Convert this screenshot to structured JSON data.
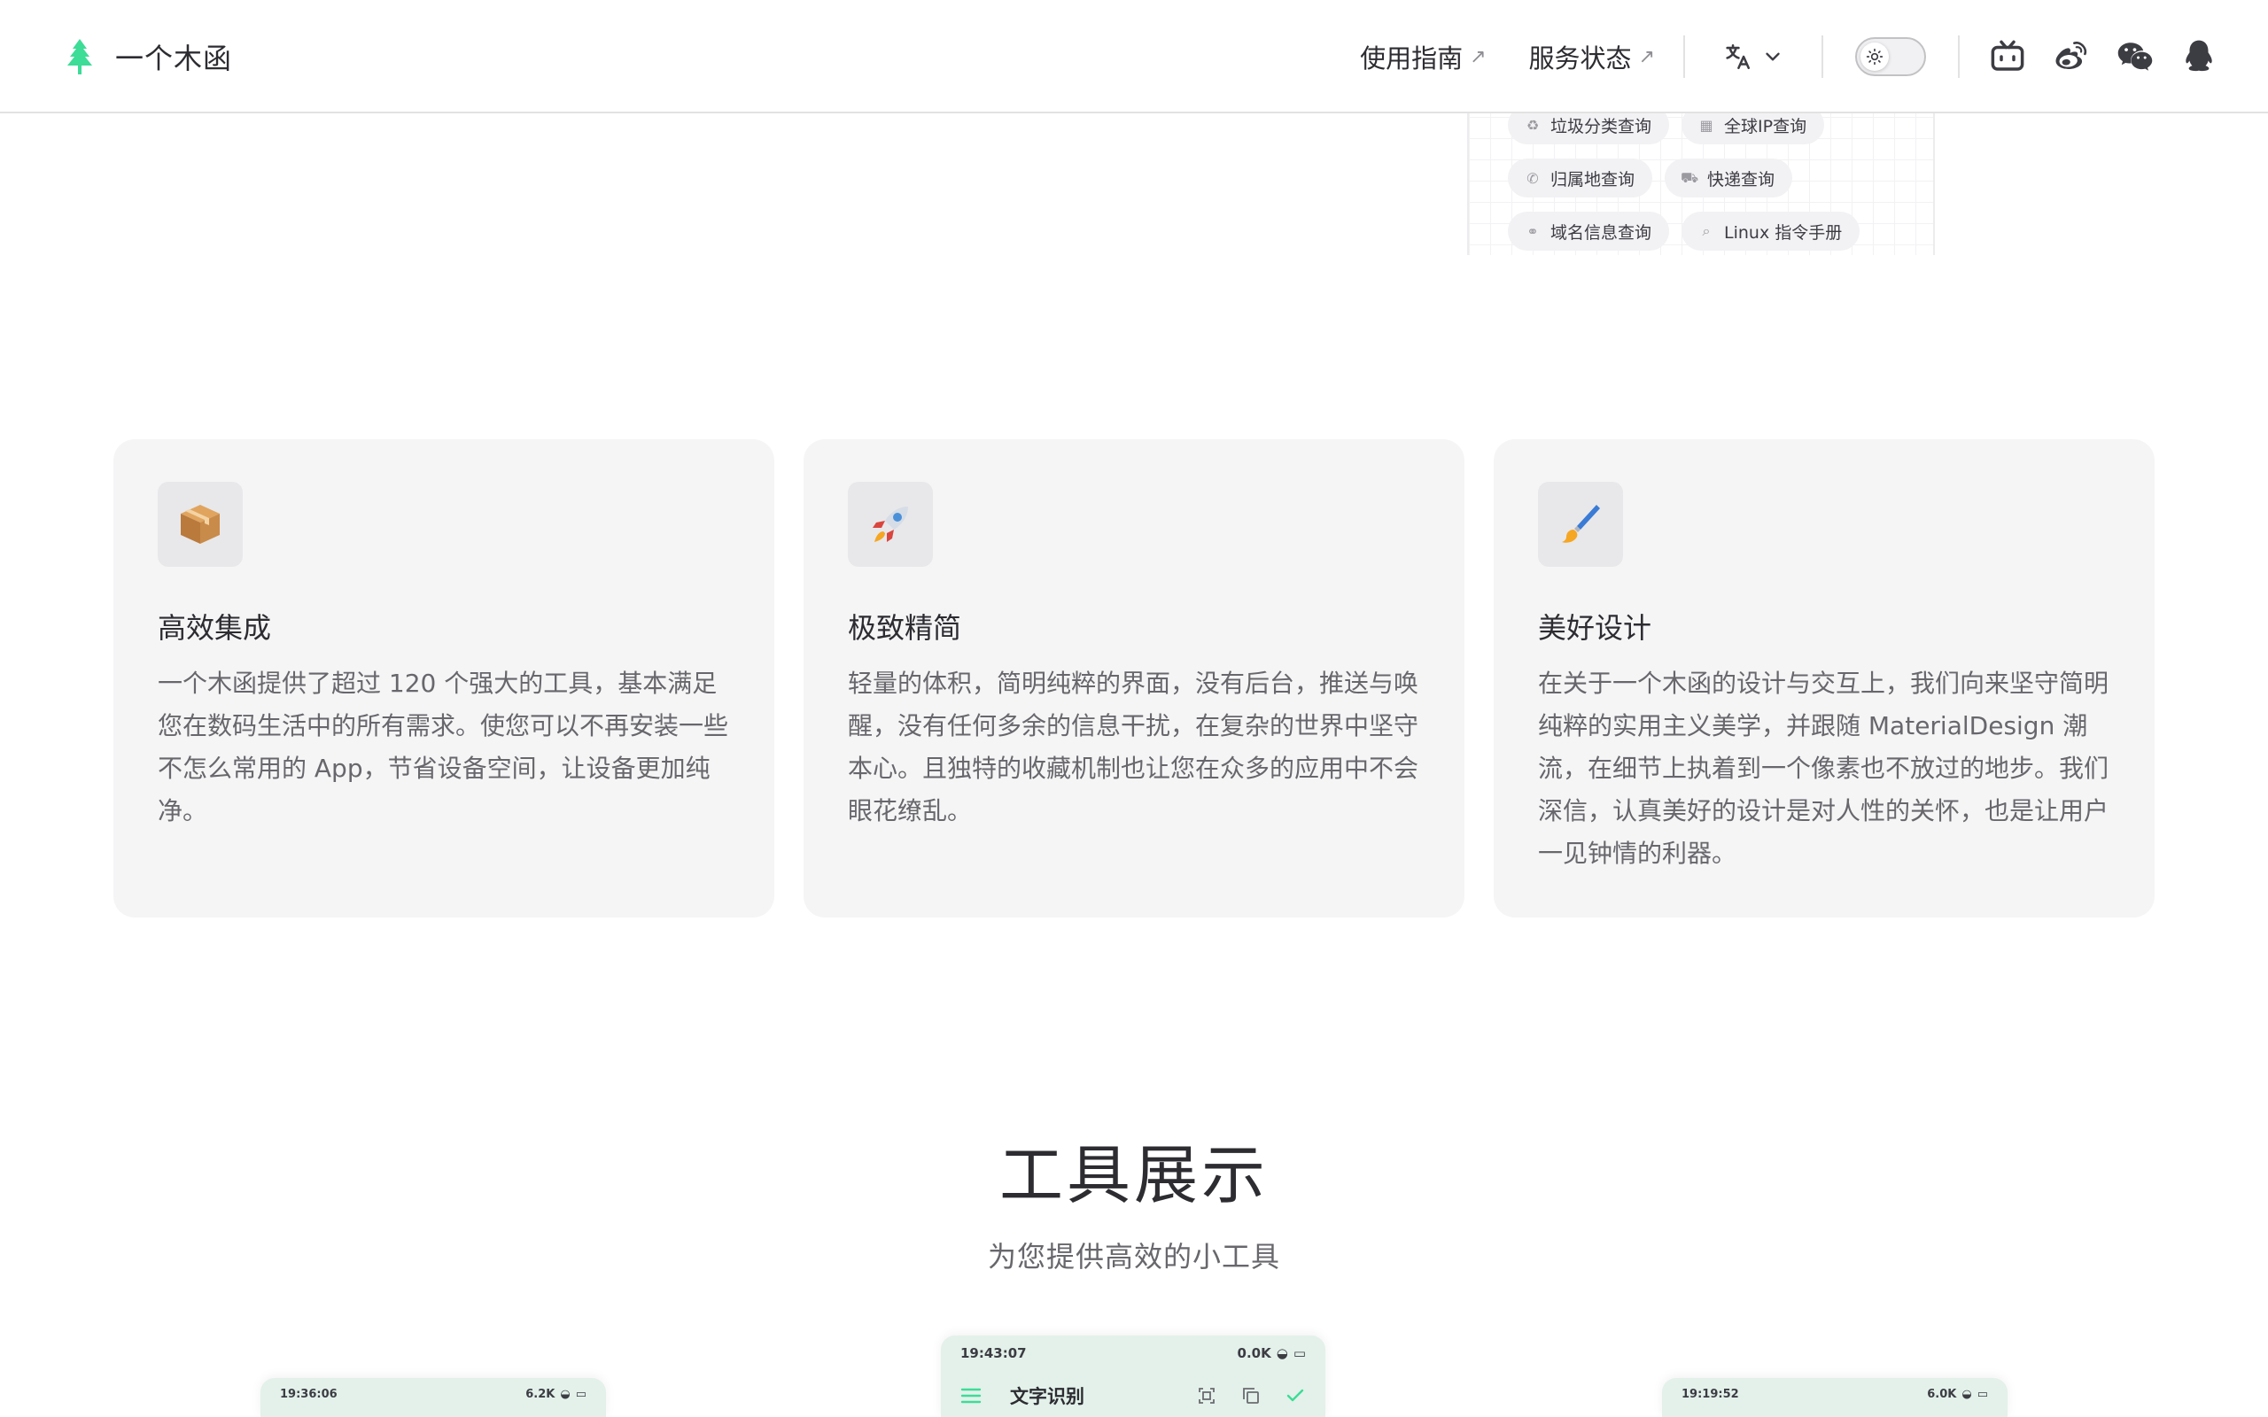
{
  "brand": {
    "name": "一个木函"
  },
  "nav": {
    "links": [
      {
        "label": "使用指南",
        "ext": "↗"
      },
      {
        "label": "服务状态",
        "ext": "↗"
      }
    ]
  },
  "preview": {
    "chips": [
      [
        {
          "label": "垃圾分类查询",
          "icon": "recycle-icon"
        },
        {
          "label": "全球IP查询",
          "icon": "ip-icon"
        }
      ],
      [
        {
          "label": "归属地查询",
          "icon": "phone-icon"
        },
        {
          "label": "快递查询",
          "icon": "truck-icon"
        }
      ],
      [
        {
          "label": "域名信息查询",
          "icon": "link-icon"
        },
        {
          "label": "Linux 指令手册",
          "icon": "search-icon"
        }
      ]
    ]
  },
  "features": [
    {
      "icon": "package-icon",
      "title": "高效集成",
      "desc": "一个木函提供了超过 120 个强大的工具，基本满足您在数码生活中的所有需求。使您可以不再安装一些不怎么常用的 App，节省设备空间，让设备更加纯净。"
    },
    {
      "icon": "rocket-icon",
      "title": "极致精简",
      "desc": "轻量的体积，简明纯粹的界面，没有后台，推送与唤醒，没有任何多余的信息干扰，在复杂的世界中坚守本心。且独特的收藏机制也让您在众多的应用中不会眼花缭乱。"
    },
    {
      "icon": "paintbrush-icon",
      "title": "美好设计",
      "desc": "在关于一个木函的设计与交互上，我们向来坚守简明纯粹的实用主义美学，并跟随 MaterialDesign 潮流，在细节上执着到一个像素也不放过的地步。我们深信，认真美好的设计是对人性的关怀，也是让用户一见钟情的利器。"
    }
  ],
  "showcase": {
    "title": "工具展示",
    "subtitle": "为您提供高效的小工具"
  },
  "phones": [
    {
      "time": "19:36:06",
      "speed": "6.2K"
    },
    {
      "time": "19:43:07",
      "speed": "0.0K",
      "title": "文字识别"
    },
    {
      "time": "19:19:52",
      "speed": "6.0K"
    }
  ],
  "colors": {
    "accent": "#3ddc97",
    "card_bg": "#f5f5f6",
    "phone_bg": "#e3f1ea"
  }
}
